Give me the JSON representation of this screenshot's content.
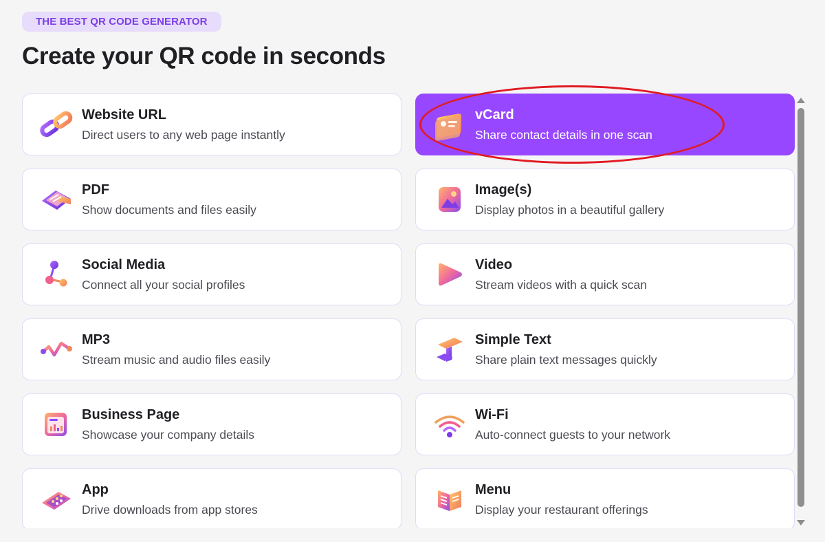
{
  "header": {
    "badge": "THE BEST QR CODE GENERATOR",
    "title": "Create your QR code in seconds"
  },
  "cards": [
    {
      "id": "website-url",
      "title": "Website URL",
      "desc": "Direct users to any web page instantly",
      "icon": "link-icon",
      "selected": false
    },
    {
      "id": "vcard",
      "title": "vCard",
      "desc": "Share contact details in one scan",
      "icon": "contact-card-icon",
      "selected": true
    },
    {
      "id": "pdf",
      "title": "PDF",
      "desc": "Show documents and files easily",
      "icon": "document-icon",
      "selected": false
    },
    {
      "id": "images",
      "title": "Image(s)",
      "desc": "Display photos in a beautiful gallery",
      "icon": "image-icon",
      "selected": false
    },
    {
      "id": "social-media",
      "title": "Social Media",
      "desc": "Connect all your social profiles",
      "icon": "share-nodes-icon",
      "selected": false
    },
    {
      "id": "video",
      "title": "Video",
      "desc": "Stream videos with a quick scan",
      "icon": "play-icon",
      "selected": false
    },
    {
      "id": "mp3",
      "title": "MP3",
      "desc": "Stream music and audio files easily",
      "icon": "audio-wave-icon",
      "selected": false
    },
    {
      "id": "simple-text",
      "title": "Simple Text",
      "desc": "Share plain text messages quickly",
      "icon": "text-icon",
      "selected": false
    },
    {
      "id": "business-page",
      "title": "Business Page",
      "desc": "Showcase your company details",
      "icon": "business-page-icon",
      "selected": false
    },
    {
      "id": "wifi",
      "title": "Wi-Fi",
      "desc": "Auto-connect guests to your network",
      "icon": "wifi-icon",
      "selected": false
    },
    {
      "id": "app",
      "title": "App",
      "desc": "Drive downloads from app stores",
      "icon": "tablet-app-icon",
      "selected": false
    },
    {
      "id": "menu",
      "title": "Menu",
      "desc": "Display your restaurant offerings",
      "icon": "menu-book-icon",
      "selected": false
    }
  ],
  "colors": {
    "accent": "#9747ff",
    "badge_bg": "#e7dcfb",
    "badge_text": "#7b3fe4",
    "annotation": "#e11b22"
  }
}
